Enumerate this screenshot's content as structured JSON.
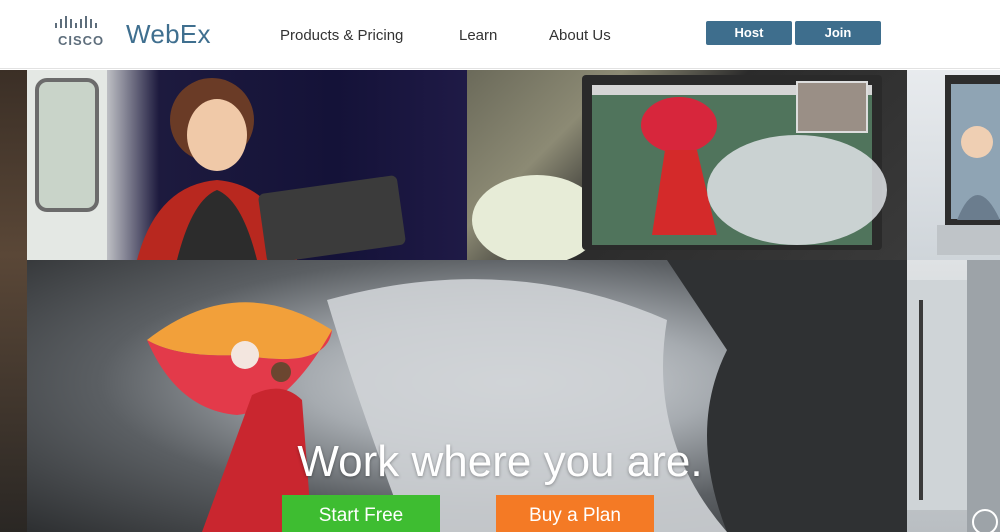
{
  "header": {
    "logo": {
      "brand": "CISCO",
      "product": "WebEx"
    },
    "nav": [
      {
        "label": "Products & Pricing"
      },
      {
        "label": "Learn"
      },
      {
        "label": "About Us"
      }
    ],
    "host_label": "Host",
    "join_label": "Join"
  },
  "hero": {
    "headline": "Work where you are.",
    "start_free_label": "Start Free",
    "buy_plan_label": "Buy a Plan"
  },
  "colors": {
    "brand_blue": "#3e6e8d",
    "start_green": "#3ebd31",
    "buy_orange": "#f47a25"
  }
}
